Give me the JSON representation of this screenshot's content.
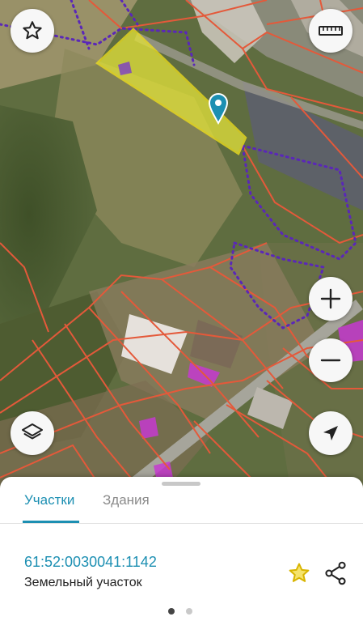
{
  "map": {
    "type": "satellite cadastral map",
    "colors": {
      "parcel_border": "#e4593a",
      "selected_fill": "#e3e33a",
      "selected_border": "#f2e21c",
      "zone_dotted": "#5a27b8",
      "highlight_magenta": "#c53ad0",
      "marker": "#1c8fb2"
    },
    "controls": {
      "favorite_icon": "star-outline-icon",
      "ruler_icon": "ruler-icon",
      "zoom_in_icon": "plus-icon",
      "zoom_out_icon": "minus-icon",
      "layers_icon": "layers-icon",
      "location_icon": "navigation-arrow-icon"
    }
  },
  "sheet": {
    "tabs": [
      {
        "label": "Участки",
        "active": true
      },
      {
        "label": "Здания",
        "active": false
      }
    ],
    "parcel": {
      "cadastral_number": "61:52:0030041:1142",
      "type": "Земельный участок"
    },
    "pagination": {
      "pages": 2,
      "current": 1
    },
    "accent": "#1c8fb2"
  }
}
